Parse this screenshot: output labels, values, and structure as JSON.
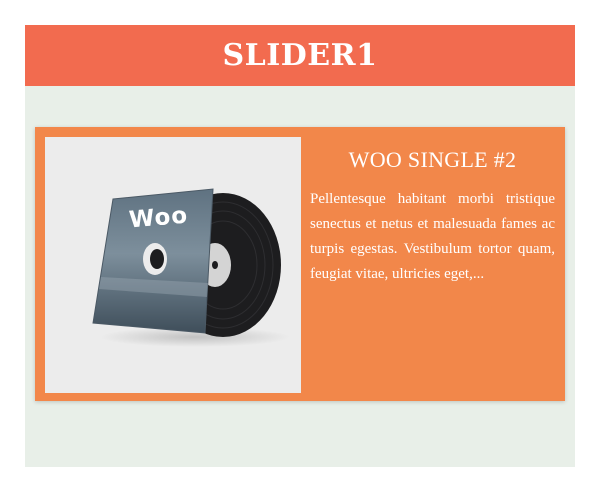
{
  "widget": {
    "title": "SLIDER1"
  },
  "slide": {
    "product_title": "WOO SINGLE #2",
    "description": "Pellentesque habitant morbi tristique senectus et netus et malesuada fames ac turpis egestas. Vestibulum tortor quam, feugiat vitae, ultricies eget,...",
    "image": {
      "sleeve_text": "Woo",
      "alt": "vinyl-record-product-image"
    }
  },
  "colors": {
    "header_bg": "#f26b4f",
    "slide_bg": "#f2874a",
    "panel_bg": "#e8efe8",
    "text": "#ffffff"
  }
}
